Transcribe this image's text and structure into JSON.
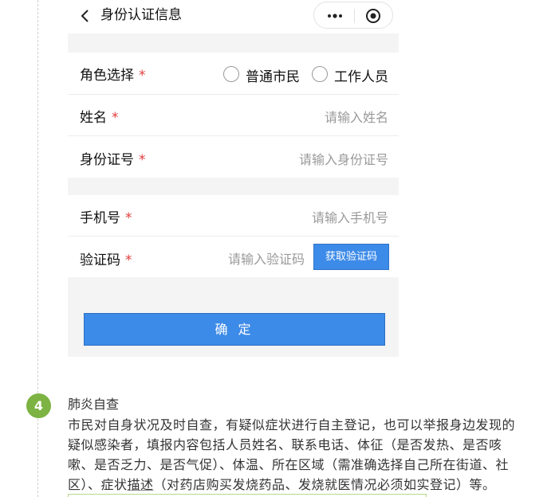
{
  "nav": {
    "title": "身份认证信息"
  },
  "form": {
    "role": {
      "label": "角色选择",
      "required_mark": "*",
      "options": [
        "普通市民",
        "工作人员"
      ]
    },
    "name": {
      "label": "姓名",
      "required_mark": "*",
      "placeholder": "请输入姓名"
    },
    "id_number": {
      "label": "身份证号",
      "required_mark": "*",
      "placeholder": "请输入身份证号"
    },
    "phone": {
      "label": "手机号",
      "required_mark": "*",
      "placeholder": "请输入手机号"
    },
    "code": {
      "label": "验证码",
      "required_mark": "*",
      "placeholder": "请输入验证码",
      "button": "获取验证码"
    },
    "confirm": "确 定"
  },
  "step": {
    "number": "4",
    "title": "肺炎自查",
    "lines": [
      "市民对自身状况及时自查，有疑似症状进行自主登记，也可以举报身边发现的",
      "疑似感染者，填报内容包括人员姓名、联系电话、体征（是否发热、是否咳",
      "嗽、是否乏力、是否气促）、体温、所在区域（需准确选择自己所在街道、社"
    ],
    "last_line_pre": "区）、症状",
    "last_line_underlined": "描述",
    "last_line_post": "（对药店购买发烧药品、发烧就医情况必须如实登记）等。"
  },
  "colors": {
    "accent": "#3d8be8",
    "required": "#e23b3b",
    "step_badge": "#7cb342"
  },
  "icons": [
    "back-icon",
    "more-icon",
    "target-icon"
  ]
}
